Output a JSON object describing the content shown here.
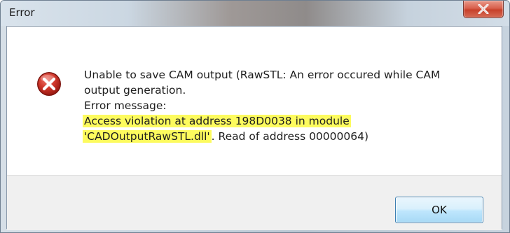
{
  "window": {
    "title": "Error"
  },
  "message": {
    "line1": "Unable to save CAM output (RawSTL: An error occured while CAM",
    "line2": "output generation.",
    "line3": "Error message:",
    "line4_highlight": "Access violation at address 198D0038 in module",
    "line5_highlight": "'CADOutputRawSTL.dll'",
    "line5_rest": ". Read of address 00000064)"
  },
  "buttons": {
    "ok_label": "OK"
  },
  "icons": {
    "close": "close-icon",
    "error": "error-icon"
  },
  "colors": {
    "highlight": "#fdfb5e",
    "error_red": "#c8281e",
    "close_red": "#c7412b"
  }
}
